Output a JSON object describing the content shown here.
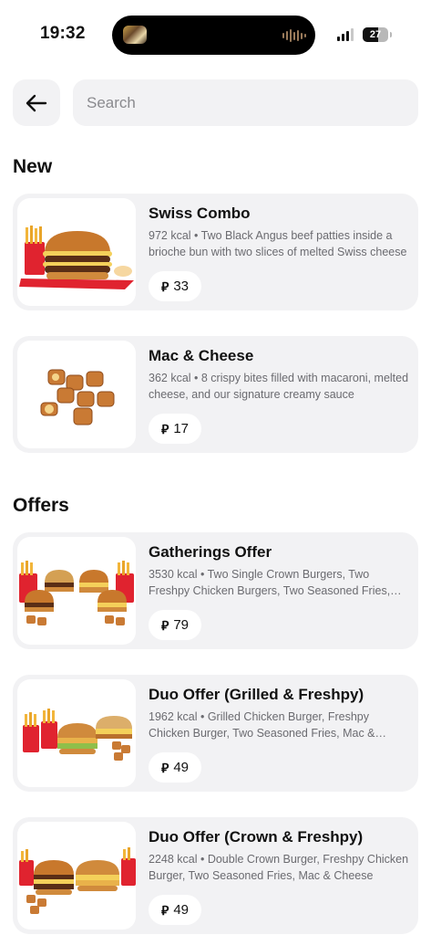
{
  "status_bar": {
    "time": "19:32",
    "battery": "27"
  },
  "header": {
    "back_icon": "arrow-left-icon",
    "search_placeholder": "Search"
  },
  "currency_symbol": "⃁",
  "sections": {
    "new": {
      "title": "New",
      "items": [
        {
          "title": "Swiss Combo",
          "description": "972 kcal • Two Black Angus beef patties inside a brioche bun with two slices of melted Swiss cheese",
          "price": "33"
        },
        {
          "title": "Mac & Cheese",
          "description": "362 kcal • 8 crispy bites filled with macaroni, melted cheese, and our signature creamy sauce",
          "price": "17"
        }
      ]
    },
    "offers": {
      "title": "Offers",
      "items": [
        {
          "title": "Gatherings Offer",
          "description": "3530 kcal • Two Single Crown Burgers, Two Freshpy Chicken Burgers, Two Seasoned Fries, Two",
          "price": "79"
        },
        {
          "title": "Duo Offer (Grilled & Freshpy)",
          "description": "1962 kcal • Grilled Chicken Burger, Freshpy Chicken Burger, Two Seasoned Fries, Mac & Cheese",
          "price": "49"
        },
        {
          "title": "Duo Offer (Crown & Freshpy)",
          "description": "2248 kcal • Double Crown Burger, Freshpy Chicken Burger, Two Seasoned Fries, Mac & Cheese",
          "price": "49"
        }
      ]
    }
  }
}
